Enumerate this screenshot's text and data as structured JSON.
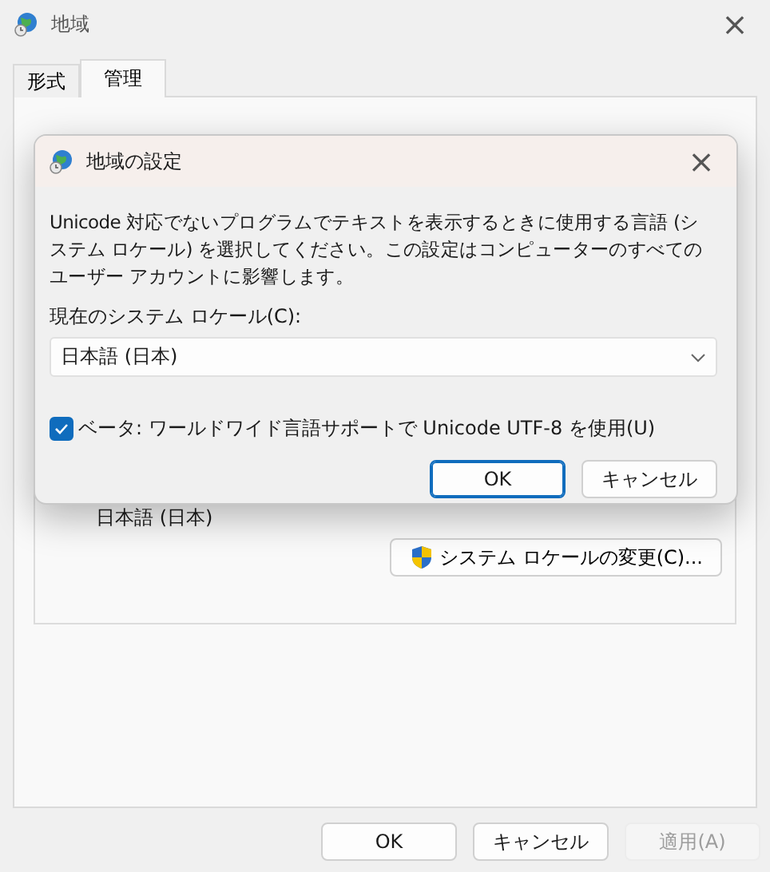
{
  "window": {
    "title": "地域",
    "close": "×"
  },
  "tabs": [
    {
      "label": "形式",
      "selected": false
    },
    {
      "label": "管理",
      "selected": true
    }
  ],
  "panel": {
    "locale_value": "日本語 (日本)",
    "change_locale_button": "システム ロケールの変更(C)..."
  },
  "buttons": [
    {
      "label": "OK",
      "disabled": false
    },
    {
      "label": "キャンセル",
      "disabled": false
    },
    {
      "label": "適用(A)",
      "disabled": true
    }
  ],
  "dialog": {
    "title": "地域の設定",
    "close": "×",
    "description": "Unicode 対応でないプログラムでテキストを表示するときに使用する言語 (システム ロケール) を選択してください。この設定はコンピューターのすべてのユーザー アカウントに影響します。",
    "locale_label": "現在のシステム ロケール(C):",
    "locale_select": "日本語 (日本)",
    "utf8_checkbox": {
      "label": "ベータ: ワールドワイド言語サポートで Unicode UTF-8 を使用(U)",
      "checked": true
    },
    "buttons": [
      {
        "label": "OK",
        "default": true
      },
      {
        "label": "キャンセル",
        "default": false
      }
    ]
  }
}
